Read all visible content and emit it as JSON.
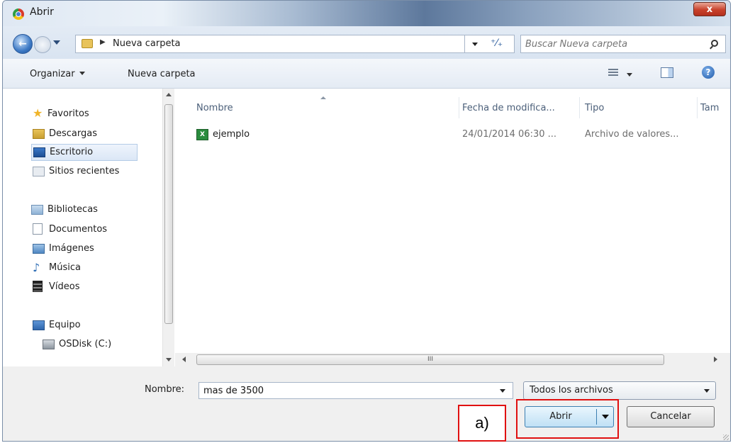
{
  "window": {
    "title": "Abrir",
    "close_glyph": "x"
  },
  "nav": {
    "back_glyph": "←",
    "breadcrumb_sep": "▶",
    "breadcrumb": "Nueva carpeta",
    "refresh_glyph": "⁺⁄₊",
    "search_placeholder": "Buscar Nueva carpeta"
  },
  "toolbar": {
    "organize": "Organizar",
    "new_folder": "Nueva carpeta",
    "help_glyph": "?"
  },
  "sidebar": {
    "items": [
      {
        "label": "Favoritos",
        "icon": "star-icon"
      },
      {
        "label": "Descargas",
        "icon": "downloads-folder-icon"
      },
      {
        "label": "Escritorio",
        "icon": "desktop-icon"
      },
      {
        "label": "Sitios recientes",
        "icon": "recent-places-icon"
      },
      {
        "label": "Bibliotecas",
        "icon": "libraries-icon"
      },
      {
        "label": "Documentos",
        "icon": "document-icon"
      },
      {
        "label": "Imágenes",
        "icon": "pictures-icon"
      },
      {
        "label": "Música",
        "icon": "music-icon"
      },
      {
        "label": "Vídeos",
        "icon": "videos-icon"
      },
      {
        "label": "Equipo",
        "icon": "computer-icon"
      },
      {
        "label": "OSDisk (C:)",
        "icon": "drive-icon"
      }
    ],
    "selected": "Escritorio"
  },
  "columns": {
    "name": "Nombre",
    "modified": "Fecha de modifica...",
    "type": "Tipo",
    "size": "Tam"
  },
  "files": [
    {
      "name": "ejemplo",
      "modified": "24/01/2014 06:30 ...",
      "type": "Archivo de valores...",
      "icon": "csv-excel-icon"
    }
  ],
  "scrollbar_grip": "III",
  "bottom": {
    "filename_label": "Nombre:",
    "filename_value": "mas de 3500",
    "filter": "Todos los archivos",
    "open": "Abrir",
    "cancel": "Cancelar"
  },
  "annotation": {
    "label": "a)",
    "color": "#e01010"
  }
}
